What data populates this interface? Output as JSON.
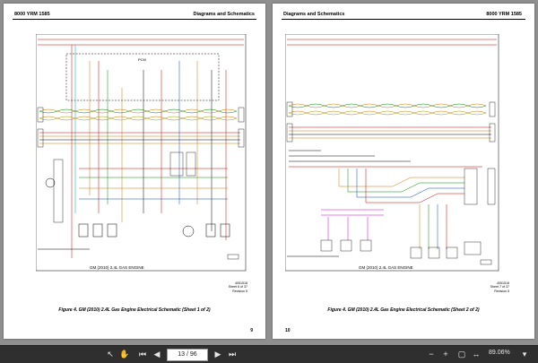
{
  "page_left": {
    "header_left": "8000 YRM 1585",
    "header_right": "Diagrams and Schematics",
    "engine_label": "GM (2010) 2.4L GAS ENGINE",
    "sheet_code": "4051518",
    "sheet_of": "Sheet 6 of 37",
    "revision": "Revision 5",
    "caption": "Figure 4. GM (2010) 2.4L Gas Engine Electrical Schematic (Sheet 1 of 2)",
    "page_number": "9",
    "ecm_label": "PCM"
  },
  "page_right": {
    "header_left": "Diagrams and Schematics",
    "header_right": "8000 YRM 1585",
    "engine_label": "GM (2010) 2.4L GAS ENGINE",
    "sheet_code": "4051518",
    "sheet_of": "Sheet 7 of 37",
    "revision": "Revision 5",
    "caption": "Figure 4. GM (2010) 2.4L Gas Engine Electrical Schematic (Sheet 2 of 2)",
    "page_number": "10"
  },
  "toolbar": {
    "page_display": "13 / 96",
    "zoom_level": "89.06%",
    "icons": [
      "cursor-icon",
      "hand-icon",
      "first-page-icon",
      "prev-page-icon",
      "next-page-icon",
      "last-page-icon",
      "zoom-out-icon",
      "zoom-in-icon",
      "fit-page-icon",
      "fit-width-icon",
      "zoom-menu-icon"
    ]
  }
}
